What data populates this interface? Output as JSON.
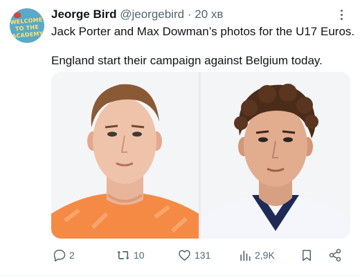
{
  "tweet": {
    "author": {
      "name": "Jeorge Bird",
      "handle": "@jeorgebird",
      "separator": "·",
      "timestamp": "20 хв",
      "avatar_text": "WELCOME TO THE ACADEMY"
    },
    "text_line1": "Jack Porter and Max Dowman’s photos for the U17 Euros.",
    "text_line2": "England start their campaign against Belgium today.",
    "media": [
      {
        "kind": "photo",
        "subject": "player in orange goalkeeper kit"
      },
      {
        "kind": "photo",
        "subject": "player in white England kit"
      }
    ],
    "actions": {
      "reply": {
        "icon": "reply-icon",
        "count": "2"
      },
      "retweet": {
        "icon": "retweet-icon",
        "count": "10"
      },
      "like": {
        "icon": "heart-icon",
        "count": "131"
      },
      "views": {
        "icon": "views-icon",
        "count": "2,9K"
      },
      "bookmark": {
        "icon": "bookmark-icon"
      },
      "share": {
        "icon": "share-icon"
      }
    }
  },
  "colors": {
    "text": "#0f1419",
    "secondary": "#536471",
    "avatar_bg": "#5aa9c9",
    "avatar_text": "#ffe46b",
    "kit_orange": "#f58a45",
    "kit_white": "#f4f6fb",
    "kit_navy": "#1f2a55"
  }
}
